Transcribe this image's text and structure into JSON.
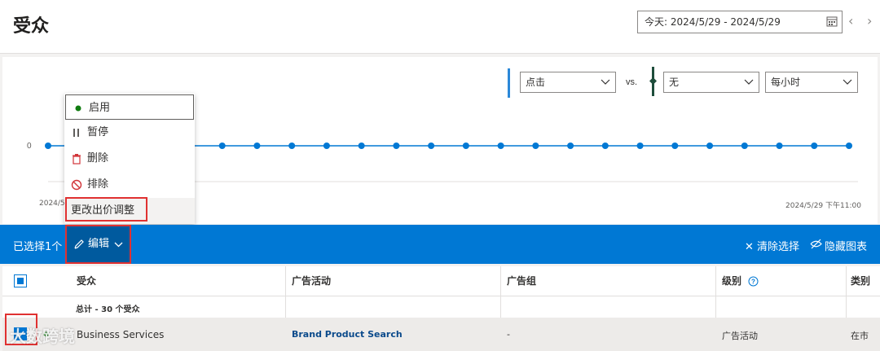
{
  "header": {
    "title": "受众",
    "date_range": "今天: 2024/5/29 - 2024/5/29",
    "prev_icon": "chevron-left-icon",
    "next_icon": "chevron-right-icon"
  },
  "chart": {
    "metric1": "点击",
    "vs": "vs.",
    "metric2": "无",
    "granularity": "每小时",
    "y_tick": "0",
    "x_start": "2024/5",
    "x_end": "2024/5/29 下午11:00",
    "line_color": "#0078d4",
    "metric1_color": "#2b88d8",
    "metric2_color": "#1e4d3b"
  },
  "chart_data": {
    "type": "line",
    "x_start": "2024/5",
    "x_end": "2024/5/29 下午11:00",
    "series": [
      {
        "values": [
          0,
          0,
          0,
          0,
          0,
          0,
          0,
          0,
          0,
          0,
          0,
          0,
          0,
          0,
          0,
          0,
          0,
          0,
          0,
          0,
          0,
          0,
          0,
          0
        ]
      }
    ],
    "ylim": [
      0,
      0
    ]
  },
  "dropdown": {
    "items": [
      {
        "label": "启用",
        "icon": "green-dot-icon"
      },
      {
        "label": "暂停",
        "icon": "pause-icon"
      },
      {
        "label": "删除",
        "icon": "trash-icon"
      },
      {
        "label": "排除",
        "icon": "block-icon"
      },
      {
        "label": "更改出价调整",
        "icon": ""
      }
    ]
  },
  "cmdbar": {
    "selected": "已选择1个",
    "edit": "编辑",
    "clear": "清除选择",
    "hide_chart": "隐藏图表"
  },
  "table": {
    "columns": [
      "受众",
      "广告活动",
      "广告组",
      "级别",
      "类别"
    ],
    "total": "总计 - 30 个受众",
    "row": {
      "audience": "Business Services",
      "campaign": "Brand Product Search",
      "ad_group": "-",
      "level": "广告活动",
      "category": "在市"
    }
  },
  "watermark": "大数跨境"
}
